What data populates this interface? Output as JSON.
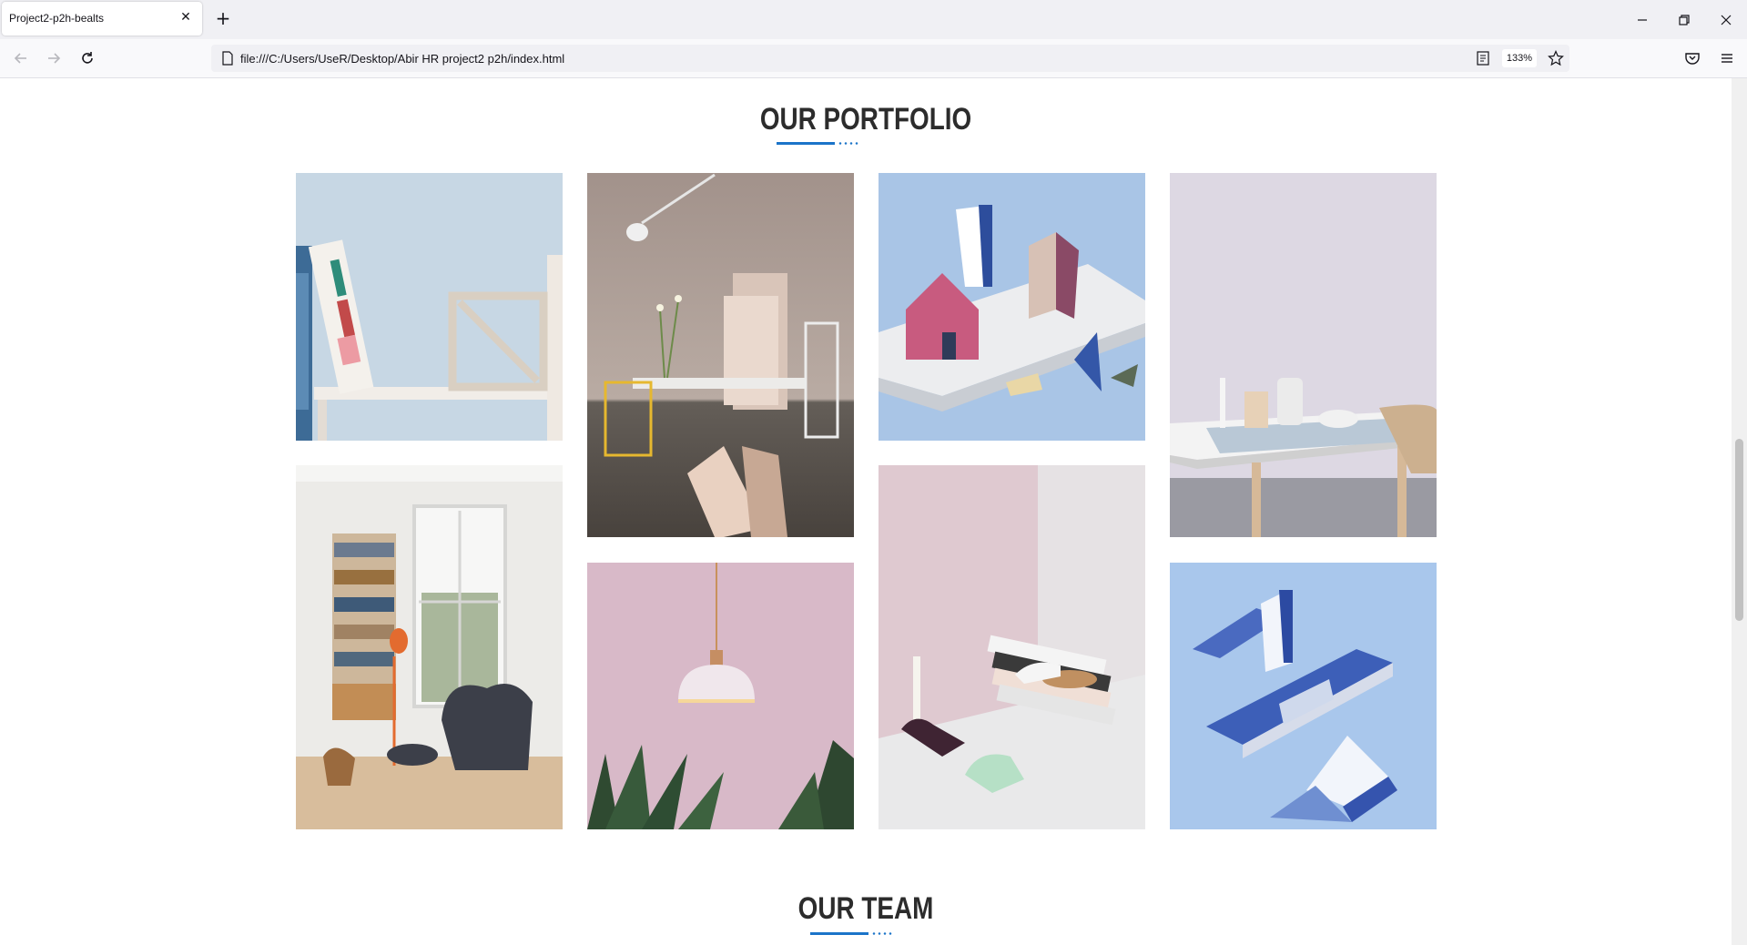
{
  "browser": {
    "tab_title": "Project2-p2h-bealts",
    "url": "file:///C:/Users/UseR/Desktop/Abir HR project2 p2h/index.html",
    "zoom": "133%"
  },
  "sections": {
    "portfolio_title": "OUR PORTFOLIO",
    "team_title": "OUR TEAM"
  },
  "portfolio": {
    "items": [
      {
        "subject": "shelf with book 'Plenty More' and wooden box",
        "palette": "light-blue"
      },
      {
        "subject": "lamp, flowers, wooden boards and yellow chair",
        "palette": "taupe"
      },
      {
        "subject": "paper house models on white block",
        "palette": "blue"
      },
      {
        "subject": "wooden table with ceramics",
        "palette": "lavender"
      },
      {
        "subject": "living room with bookshelf and armchairs",
        "palette": "white"
      },
      {
        "subject": "pendant lamp with plants",
        "palette": "pink"
      },
      {
        "subject": "candle holder and stacked magazines",
        "palette": "mauve"
      },
      {
        "subject": "blue paper stands and books",
        "palette": "sky-blue"
      }
    ]
  },
  "colors": {
    "accent": "#1b74c9",
    "heading": "#2c2c2c"
  }
}
